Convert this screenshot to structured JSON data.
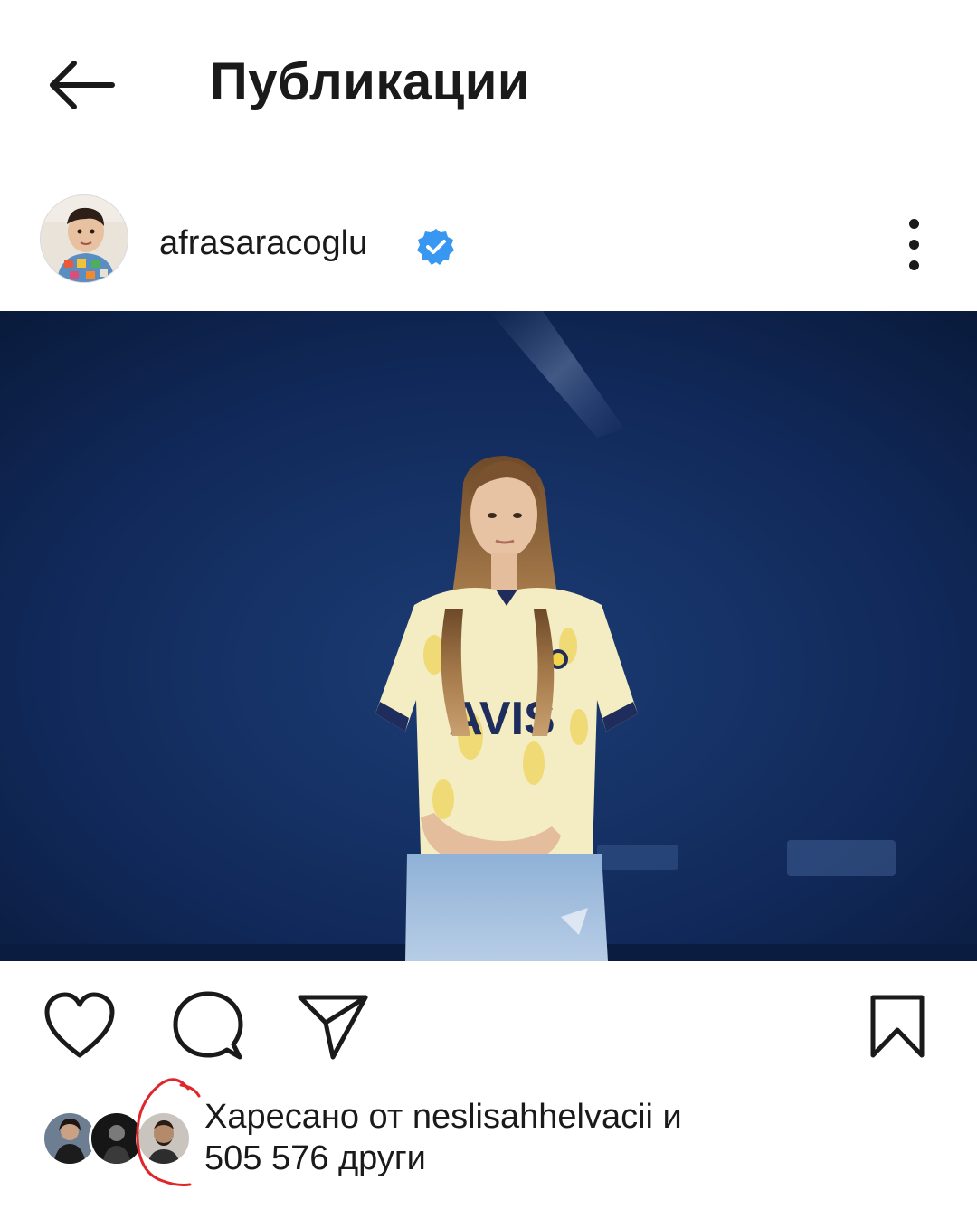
{
  "header": {
    "title": "Публикации",
    "back_icon": "arrow-left-icon"
  },
  "post": {
    "username": "afrasaracoglu",
    "verified": true,
    "verified_color": "#3897f0",
    "image_text": "AVIS",
    "likes": {
      "prefix": "Харесано от",
      "liked_by": "neslisahhelvacii",
      "conjunction": "и",
      "count": "505 576",
      "suffix": "други"
    }
  },
  "actions": {
    "like_icon": "heart-icon",
    "comment_icon": "comment-icon",
    "share_icon": "send-icon",
    "save_icon": "bookmark-icon"
  },
  "colors": {
    "annotation_red": "#e0262a",
    "background": "#ffffff",
    "text": "#1a1a1a"
  }
}
